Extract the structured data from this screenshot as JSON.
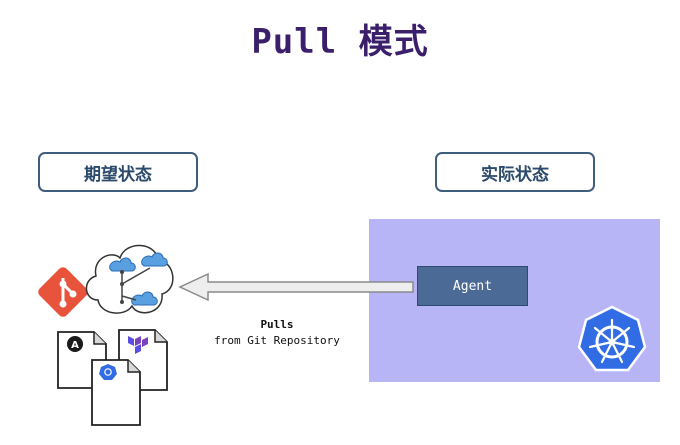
{
  "title": "Pull 模式",
  "desired_state": {
    "label": "期望状态"
  },
  "actual_state": {
    "label": "实际状态"
  },
  "agent": {
    "label": "Agent"
  },
  "arrow": {
    "line1": "Pulls",
    "line2": "from Git Repository"
  },
  "icons": {
    "git": "git-logo-icon",
    "cloud": "config-cloud-icon",
    "ansible": "ansible-file-icon",
    "terraform": "terraform-file-icon",
    "kubernetes_file": "kubernetes-file-icon",
    "kubernetes": "kubernetes-logo-icon"
  },
  "colors": {
    "title": "#3b1f6b",
    "box_border": "#3f5d7d",
    "cluster_bg": "#b8b5f7",
    "agent_bg": "#4b6a96",
    "git": "#e8543b",
    "kubernetes": "#326ce5"
  }
}
